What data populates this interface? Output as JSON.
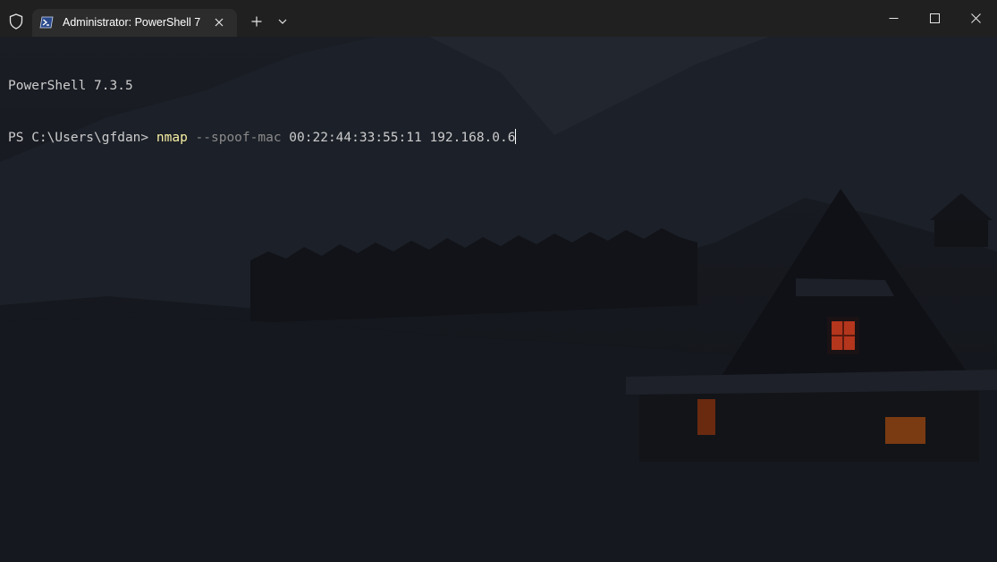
{
  "window": {
    "tab": {
      "title": "Administrator: PowerShell 7",
      "icon": "powershell-icon"
    },
    "icons": {
      "shield": "shield-icon",
      "close_tab": "close-icon",
      "new_tab": "plus-icon",
      "dropdown": "chevron-down-icon",
      "minimize": "minimize-icon",
      "maximize": "maximize-icon",
      "close": "close-icon"
    }
  },
  "terminal": {
    "banner": "PowerShell 7.3.5",
    "prompt": "PS C:\\Users\\gfdan> ",
    "command": "nmap",
    "parameter": "--spoof-mac",
    "arg1": "00:22:44:33:55:11",
    "arg2": "192.168.0.6"
  },
  "colors": {
    "titlebar": "#202020",
    "active_tab": "#2c2c2c",
    "command": "#f9f1a5",
    "parameter": "#8a8a8a",
    "text": "#cccccc"
  }
}
